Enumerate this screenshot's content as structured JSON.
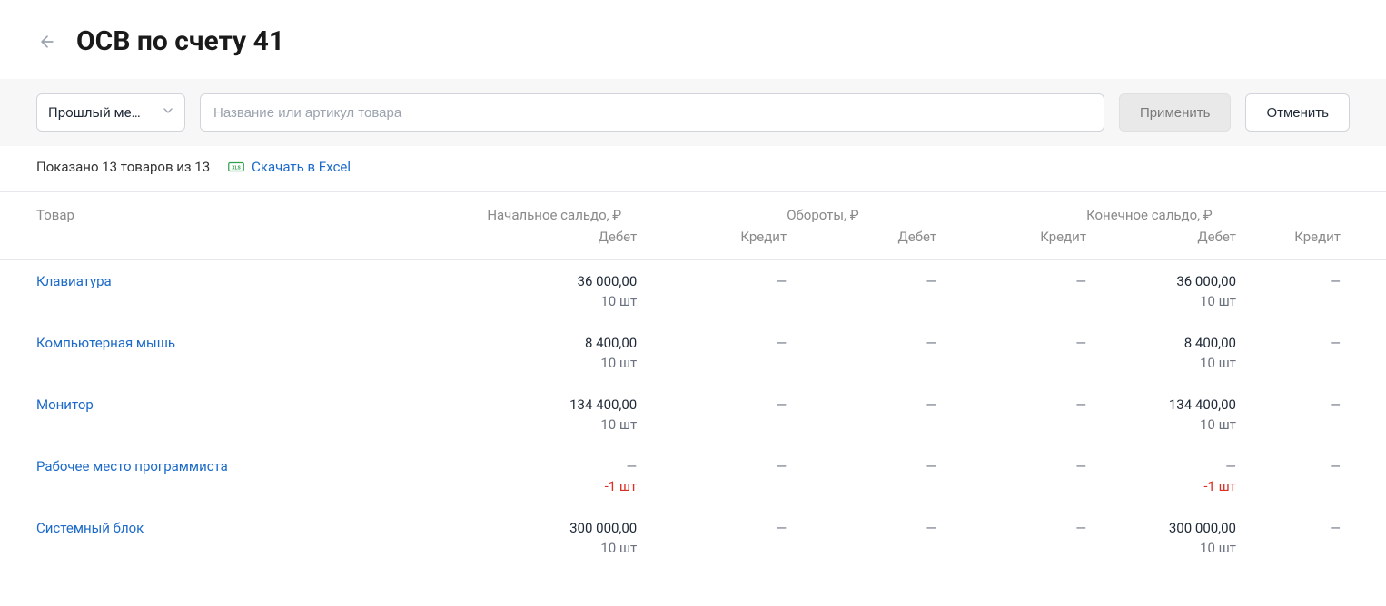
{
  "header": {
    "title": "ОСВ по счету 41"
  },
  "filters": {
    "period_label": "Прошлый ме…",
    "search_placeholder": "Название или артикул товара",
    "apply_label": "Применить",
    "cancel_label": "Отменить"
  },
  "status": {
    "shown_text": "Показано 13 товаров из 13",
    "download_label": "Скачать в Excel"
  },
  "table": {
    "headers": {
      "product": "Товар",
      "opening_balance": "Начальное сальдо, ₽",
      "turnover": "Обороты, ₽",
      "closing_balance": "Конечное сальдо, ₽",
      "debit": "Дебет",
      "credit": "Кредит"
    },
    "rows": [
      {
        "name": "Клавиатура",
        "opening_debit": "36 000,00",
        "opening_debit_qty": "10 шт",
        "opening_credit": "—",
        "turnover_debit": "—",
        "turnover_credit": "—",
        "closing_debit": "36 000,00",
        "closing_debit_qty": "10 шт",
        "closing_credit": "—",
        "qty_negative": false
      },
      {
        "name": "Компьютерная мышь",
        "opening_debit": "8 400,00",
        "opening_debit_qty": "10 шт",
        "opening_credit": "—",
        "turnover_debit": "—",
        "turnover_credit": "—",
        "closing_debit": "8 400,00",
        "closing_debit_qty": "10 шт",
        "closing_credit": "—",
        "qty_negative": false
      },
      {
        "name": "Монитор",
        "opening_debit": "134 400,00",
        "opening_debit_qty": "10 шт",
        "opening_credit": "—",
        "turnover_debit": "—",
        "turnover_credit": "—",
        "closing_debit": "134 400,00",
        "closing_debit_qty": "10 шт",
        "closing_credit": "—",
        "qty_negative": false
      },
      {
        "name": "Рабочее место программиста",
        "opening_debit": "—",
        "opening_debit_qty": "-1 шт",
        "opening_credit": "—",
        "turnover_debit": "—",
        "turnover_credit": "—",
        "closing_debit": "—",
        "closing_debit_qty": "-1 шт",
        "closing_credit": "—",
        "qty_negative": true
      },
      {
        "name": "Системный блок",
        "opening_debit": "300 000,00",
        "opening_debit_qty": "10 шт",
        "opening_credit": "—",
        "turnover_debit": "—",
        "turnover_credit": "—",
        "closing_debit": "300 000,00",
        "closing_debit_qty": "10 шт",
        "closing_credit": "—",
        "qty_negative": false
      }
    ]
  }
}
